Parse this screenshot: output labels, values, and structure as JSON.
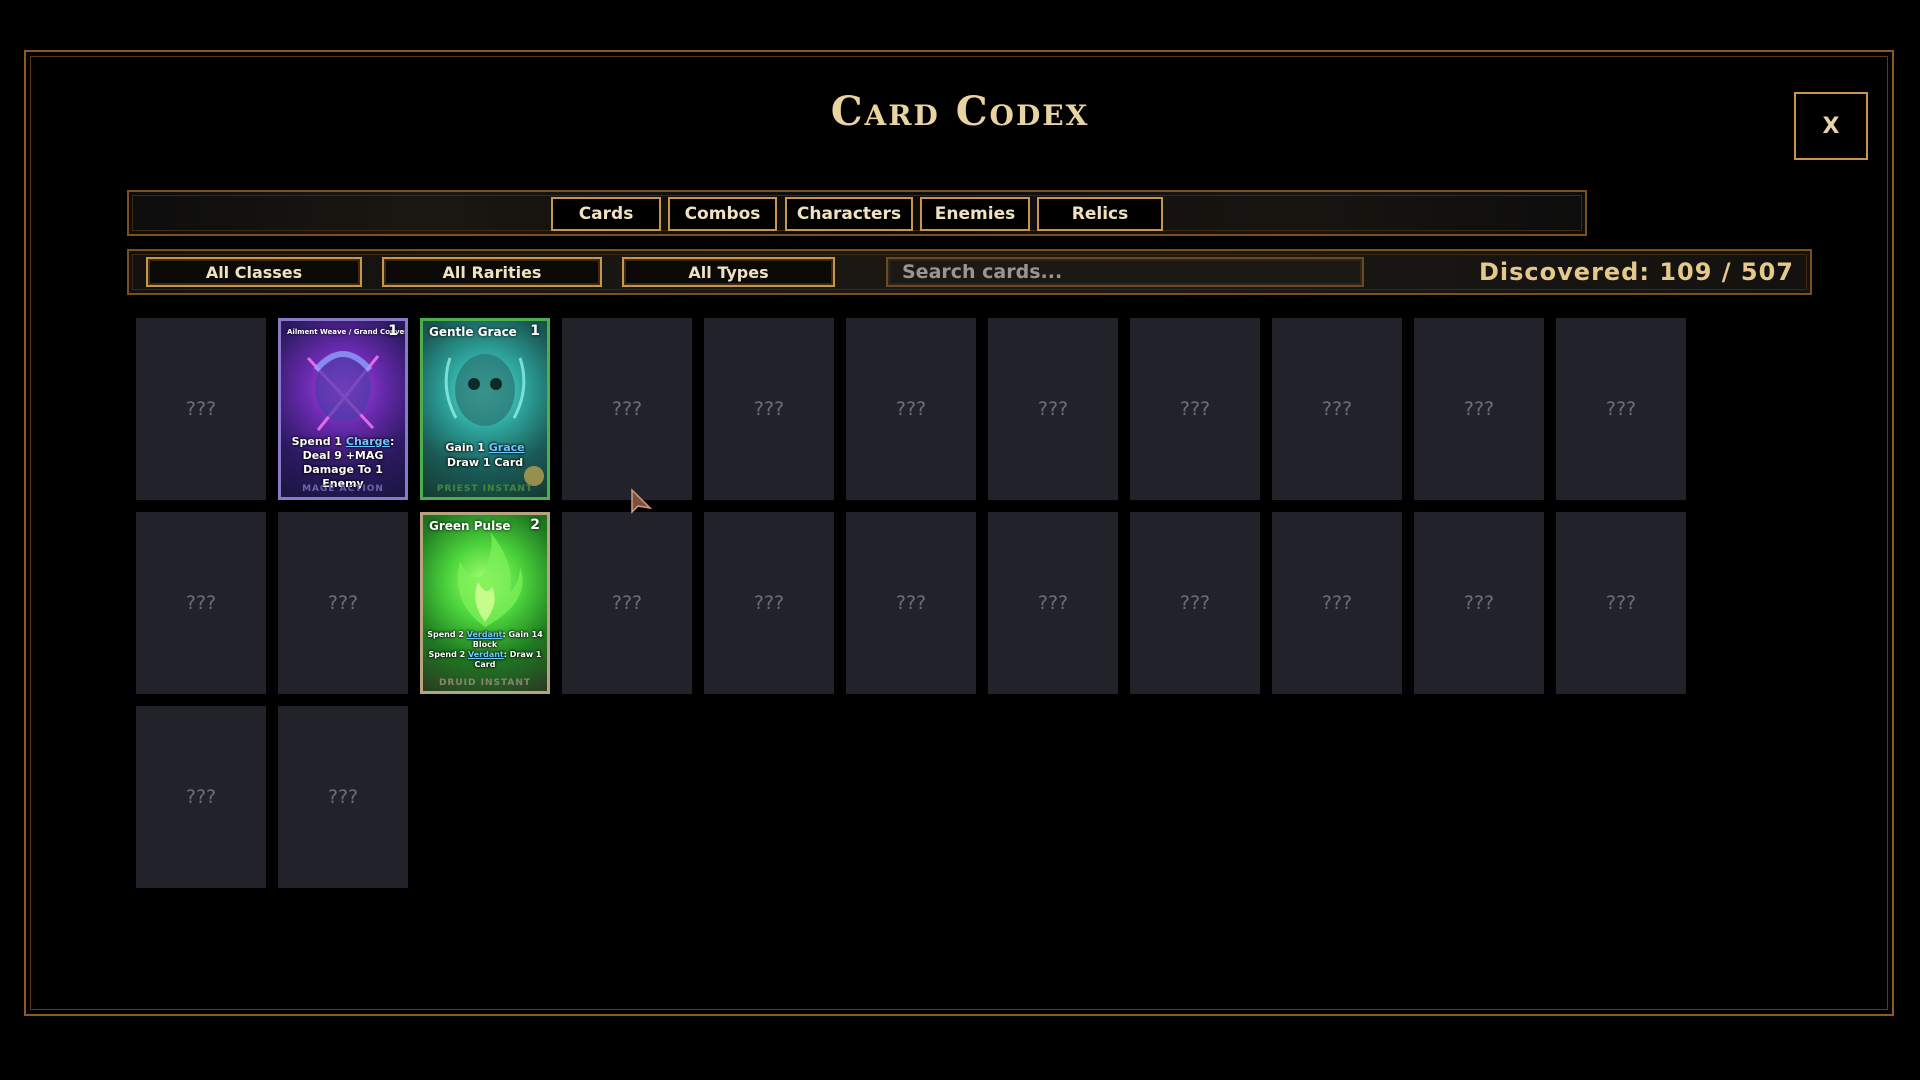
{
  "title": "Card Codex",
  "close_label": "X",
  "tabs": [
    {
      "label": "Cards"
    },
    {
      "label": "Combos"
    },
    {
      "label": "Characters"
    },
    {
      "label": "Enemies"
    },
    {
      "label": "Relics"
    }
  ],
  "filters": {
    "class": "All Classes",
    "rarity": "All Rarities",
    "type": "All Types"
  },
  "search": {
    "placeholder": "Search cards...",
    "value": ""
  },
  "discovered": "Discovered: 109 / 507",
  "locked_label": "???",
  "cards": {
    "card1": {
      "name": "Ailment Weave / Grand Convergence...",
      "cost": "1",
      "desc_a": "Spend 1 ",
      "keyword": "Charge",
      "desc_b": ": Deal 9 +MAG Damage To 1 Enemy",
      "footer": "MAGE ACTION",
      "border_color": "#8a78c8"
    },
    "card2": {
      "name": "Gentle Grace",
      "cost": "1",
      "line1_a": "Gain 1 ",
      "keyword": "Grace",
      "line2": "Draw 1 Card",
      "footer": "PRIEST INSTANT",
      "border_color": "#4cae4c"
    },
    "card3": {
      "name": "Green Pulse",
      "cost": "2",
      "line1_a": "Spend 2 ",
      "keyword1": "Verdant",
      "line1_b": ": Gain 14 Block",
      "line2_a": "Spend 2 ",
      "keyword2": "Verdant",
      "line2_b": ": Draw 1 Card",
      "footer": "DRUID INSTANT",
      "border_color": "#b8a47c"
    }
  }
}
